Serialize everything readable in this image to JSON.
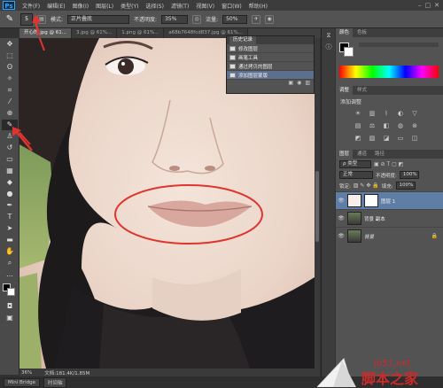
{
  "menu": [
    "文件(F)",
    "编辑(E)",
    "图像(I)",
    "图层(L)",
    "类型(Y)",
    "选择(S)",
    "滤镜(T)",
    "视图(V)",
    "窗口(W)",
    "帮助(H)"
  ],
  "options": {
    "brush_size": "5",
    "mode_label": "模式:",
    "mode_value": "正片叠底",
    "opacity_label": "不透明度:",
    "opacity_value": "35%",
    "flow_label": "流量:",
    "flow_value": "50%"
  },
  "tabs": [
    "开心的.jpg @ 61...",
    "3.jpg @ 61%...",
    "1.png @ 61%...",
    "a68b7648fcd837.jpg @ 61%..."
  ],
  "history": {
    "title": "历史记录",
    "items": [
      "修改图层",
      "画笔工具",
      "通过拷贝的图层",
      "添加图层蒙版"
    ]
  },
  "color_panel": {
    "tabs": [
      "颜色",
      "色板"
    ],
    "fg": "#000000",
    "bg": "#ffffff"
  },
  "adjust_panel": {
    "tabs": [
      "调整",
      "样式"
    ],
    "title": "添加调整"
  },
  "layers_panel": {
    "tabs": [
      "图层",
      "通道",
      "路径"
    ],
    "filter": "ρ 类型",
    "blend_mode": "正常",
    "opacity_label": "不透明度:",
    "opacity_value": "100%",
    "lock_label": "锁定:",
    "fill_label": "填充:",
    "fill_value": "100%",
    "layers": [
      {
        "name": "图层 1",
        "selected": true
      },
      {
        "name": "背景 副本",
        "selected": false
      },
      {
        "name": "背景",
        "selected": false
      }
    ]
  },
  "status": {
    "zoom": "36%",
    "doc": "文档:181.4K/1.85M"
  },
  "bottom": {
    "mini_bridge": "Mini Bridge",
    "timeline": "时间轴"
  },
  "watermark": {
    "domain": "jb51.net",
    "name": "脚本之家"
  },
  "colors": {
    "accent": "#e0342f",
    "selection": "#5f7ea6"
  }
}
